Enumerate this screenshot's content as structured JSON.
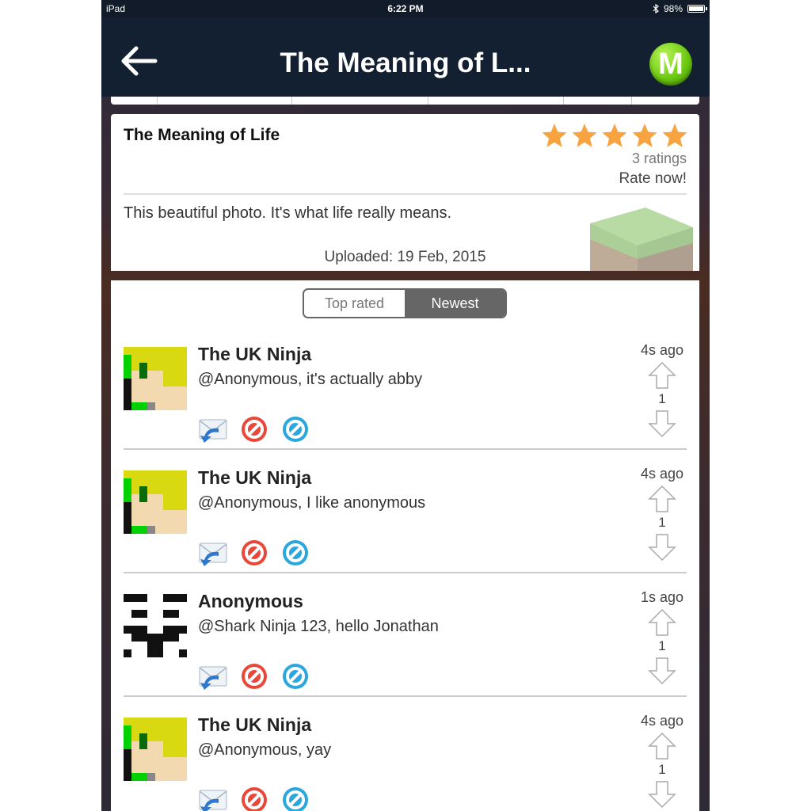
{
  "status_bar": {
    "device": "iPad",
    "time": "6:22 PM",
    "battery": "98%"
  },
  "nav": {
    "title": "The Meaning of L...",
    "logo_letter": "M"
  },
  "post": {
    "title": "The Meaning of Life",
    "rating_stars": 5,
    "ratings_count": "3 ratings",
    "rate_now": "Rate now!",
    "description": "This beautiful photo. It's what life really means.",
    "uploaded": "Uploaded: 19 Feb, 2015"
  },
  "sort_tabs": {
    "top_rated": "Top rated",
    "newest": "Newest",
    "selected": "newest"
  },
  "comments": [
    {
      "author": "The UK Ninja",
      "text": "@Anonymous, it's actually abby",
      "time": "4s ago",
      "score": "1",
      "avatar": "ninja-avatar"
    },
    {
      "author": "The UK Ninja",
      "text": "@Anonymous, I like anonymous",
      "time": "4s ago",
      "score": "1",
      "avatar": "ninja-avatar"
    },
    {
      "author": "Anonymous",
      "text": "@Shark Ninja 123, hello Jonathan",
      "time": "1s ago",
      "score": "1",
      "avatar": "anonymous-mask-avatar"
    },
    {
      "author": "The UK Ninja",
      "text": "@Anonymous, yay",
      "time": "4s ago",
      "score": "1",
      "avatar": "ninja-avatar"
    }
  ],
  "colors": {
    "nav_bg": "#132032",
    "logo_green": "#6fcb12",
    "star": "#f7a440",
    "selected_tab": "#666666"
  }
}
